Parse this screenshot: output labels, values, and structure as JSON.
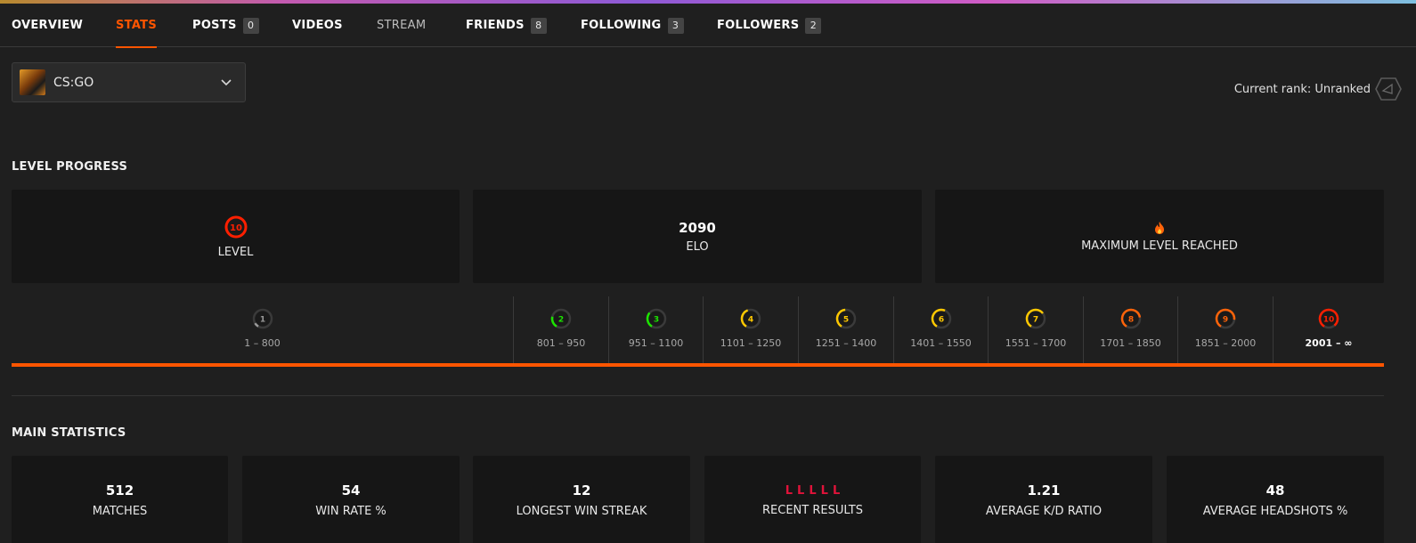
{
  "tabs": [
    {
      "label": "OVERVIEW"
    },
    {
      "label": "STATS"
    },
    {
      "label": "POSTS",
      "count": "0"
    },
    {
      "label": "VIDEOS"
    },
    {
      "label": "STREAM"
    },
    {
      "label": "FRIENDS",
      "count": "8"
    },
    {
      "label": "FOLLOWING",
      "count": "3"
    },
    {
      "label": "FOLLOWERS",
      "count": "2"
    }
  ],
  "active_tab": "STATS",
  "game_select": {
    "value": "CS:GO",
    "icon": "chevron-down-icon"
  },
  "rank": {
    "label": "Current rank: Unranked",
    "icon": "unranked-hexagon-icon"
  },
  "level_progress": {
    "title": "LEVEL PROGRESS",
    "level": {
      "value": "10",
      "label": "LEVEL"
    },
    "elo": {
      "value": "2090",
      "label": "ELO"
    },
    "max": {
      "icon": "fire-icon",
      "label": "MAXIMUM LEVEL REACHED"
    },
    "levels": [
      {
        "level": "1",
        "range": "1 – 800",
        "color": "#9a9a9a",
        "fill": 0.1
      },
      {
        "level": "2",
        "range": "801 – 950",
        "color": "#1ce400",
        "fill": 0.25
      },
      {
        "level": "3",
        "range": "951 – 1100",
        "color": "#1ce400",
        "fill": 0.35
      },
      {
        "level": "4",
        "range": "1101 – 1250",
        "color": "#ffc800",
        "fill": 0.45
      },
      {
        "level": "5",
        "range": "1251 – 1400",
        "color": "#ffc800",
        "fill": 0.5
      },
      {
        "level": "6",
        "range": "1401 – 1550",
        "color": "#ffc800",
        "fill": 0.6
      },
      {
        "level": "7",
        "range": "1551 – 1700",
        "color": "#ffc800",
        "fill": 0.7
      },
      {
        "level": "8",
        "range": "1701 – 1850",
        "color": "#ff6309",
        "fill": 0.8
      },
      {
        "level": "9",
        "range": "1851 – 2000",
        "color": "#ff6309",
        "fill": 0.85
      },
      {
        "level": "10",
        "range": "2001 – ∞",
        "color": "#fe1f00",
        "fill": 1.0
      }
    ],
    "current_level": "10",
    "level10_color": "#fe1f00"
  },
  "main_statistics": {
    "title": "MAIN STATISTICS",
    "matches": {
      "value": "512",
      "label": "MATCHES"
    },
    "win_rate": {
      "value": "54",
      "label": "WIN RATE %"
    },
    "longest_streak": {
      "value": "12",
      "label": "LONGEST WIN STREAK"
    },
    "recent_results": {
      "values": [
        "L",
        "L",
        "L",
        "L",
        "L"
      ],
      "label": "RECENT RESULTS",
      "color": "#e0133a"
    },
    "kd_ratio": {
      "value": "1.21",
      "label": "AVERAGE K/D RATIO"
    },
    "headshots": {
      "value": "48",
      "label": "AVERAGE HEADSHOTS %"
    }
  },
  "colors": {
    "accent": "#ff5500",
    "background": "#1f1f1f",
    "card": "#161616"
  }
}
